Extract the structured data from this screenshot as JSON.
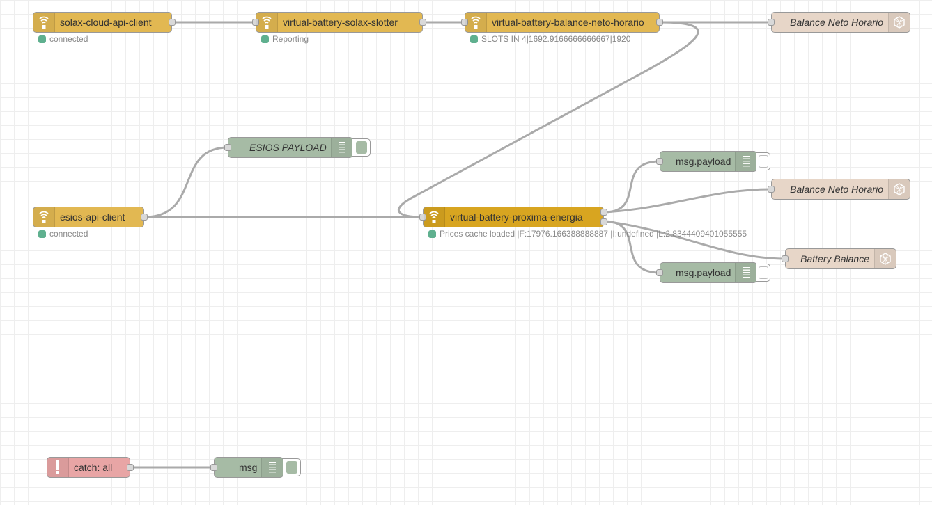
{
  "colors": {
    "mqtt_node": "#e2b852",
    "mqtt_node_active": "#d8a520",
    "debug_node": "#a6bba5",
    "dashboard_node": "#e7d6c8",
    "catch_node": "#e8a5a5",
    "wire": "#aaaaaa",
    "status_connected": "#5fb08f",
    "grid_bg": "#ffffff"
  },
  "nodes": {
    "solax_client": {
      "label": "solax-cloud-api-client",
      "status": "connected",
      "icon": "wifi-icon"
    },
    "solax_slotter": {
      "label": "virtual-battery-solax-slotter",
      "status": "Reporting",
      "icon": "wifi-icon"
    },
    "balance_neto": {
      "label": "virtual-battery-balance-neto-horario",
      "status": "SLOTS IN 4|1692.9166666666667|1920",
      "icon": "wifi-icon"
    },
    "ui_balance_top": {
      "label": "Balance Neto Horario",
      "icon": "globe-icon"
    },
    "esios_payload": {
      "label": "ESIOS PAYLOAD",
      "icon": "list-icon"
    },
    "esios_client": {
      "label": "esios-api-client",
      "status": "connected",
      "icon": "wifi-icon"
    },
    "proxima_energia": {
      "label": "virtual-battery-proxima-energia",
      "status": "Prices cache loaded |F:17976.166388888887 |I:undefined |L:2.8344409401055555",
      "icon": "wifi-icon"
    },
    "debug_payload_1": {
      "label": "msg.payload",
      "icon": "list-icon"
    },
    "ui_balance_mid": {
      "label": "Balance Neto Horario",
      "icon": "globe-icon"
    },
    "ui_battery_balance": {
      "label": "Battery Balance",
      "icon": "globe-icon"
    },
    "debug_payload_2": {
      "label": "msg.payload",
      "icon": "list-icon"
    },
    "catch_all": {
      "label": "catch: all",
      "icon": "alert-icon"
    },
    "debug_msg": {
      "label": "msg",
      "icon": "list-icon"
    }
  }
}
